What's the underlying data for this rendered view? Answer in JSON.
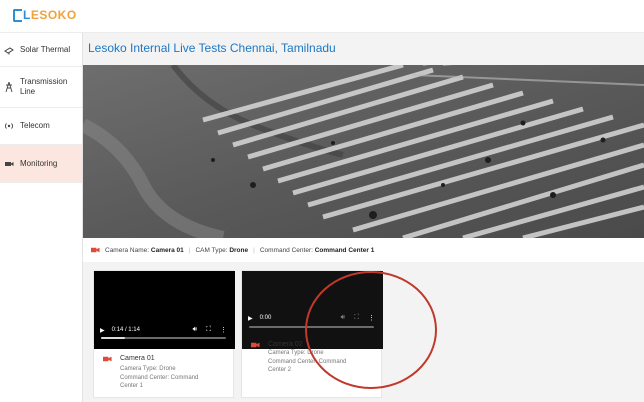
{
  "brand": {
    "logo_text": "LESOKO",
    "logo_initial": "L",
    "logo_rest": "ESOKO"
  },
  "sidebar": {
    "items": [
      {
        "label": "Solar Thermal",
        "icon": "solar-panel-icon",
        "active": false
      },
      {
        "label": "Transmission Line",
        "icon": "transmission-tower-icon",
        "active": false
      },
      {
        "label": "Telecom",
        "icon": "telecom-icon",
        "active": false
      },
      {
        "label": "Monitoring",
        "icon": "camera-icon",
        "active": true
      }
    ]
  },
  "page": {
    "title": "Lesoko Internal Live Tests Chennai, Tamilnadu"
  },
  "main_camera": {
    "name_label": "Camera Name:",
    "name_value": "Camera 01",
    "type_label": "CAM Type:",
    "type_value": "Drone",
    "center_label": "Command Center:",
    "center_value": "Command Center 1"
  },
  "cameras": [
    {
      "name": "Camera 01",
      "type_line": "Camera Type: Drone",
      "center_line1": "Command Center: Command",
      "center_line2": "Center 1",
      "time": "0:14 / 1:14",
      "progress": 0.19
    },
    {
      "name": "Camera 02",
      "type_line": "Camera Type: Drone",
      "center_line1": "Command Center: Command",
      "center_line2": "Center 2",
      "time": "0:00",
      "progress": 0.0
    }
  ],
  "colors": {
    "accent": "#1d77c4",
    "brand_orange": "#f0a23c",
    "highlight": "#c0392b",
    "active_bg": "#fbe7df"
  }
}
